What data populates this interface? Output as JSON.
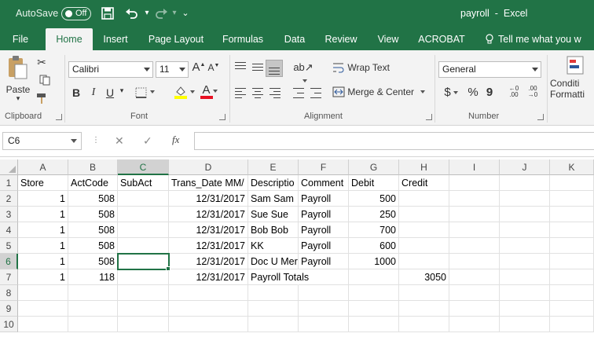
{
  "titlebar": {
    "autosave_label": "AutoSave",
    "autosave_state": "Off",
    "title": "payroll  -  Excel"
  },
  "tabs": [
    {
      "label": "File",
      "active": false
    },
    {
      "label": "Home",
      "active": true
    },
    {
      "label": "Insert",
      "active": false
    },
    {
      "label": "Page Layout",
      "active": false
    },
    {
      "label": "Formulas",
      "active": false
    },
    {
      "label": "Data",
      "active": false
    },
    {
      "label": "Review",
      "active": false
    },
    {
      "label": "View",
      "active": false
    },
    {
      "label": "ACROBAT",
      "active": false
    },
    {
      "label": "Tell me what you w",
      "active": false
    }
  ],
  "ribbon": {
    "clipboard": {
      "paste_label": "Paste",
      "group_label": "Clipboard"
    },
    "font": {
      "font_name": "Calibri",
      "font_size": "11",
      "group_label": "Font",
      "bold": "B",
      "italic": "I",
      "underline": "U",
      "font_color_glyph": "A",
      "font_color": "#e81123",
      "fill_color": "#ffff00"
    },
    "alignment": {
      "wrap_text": "Wrap Text",
      "merge_center": "Merge & Center",
      "group_label": "Alignment"
    },
    "number": {
      "format": "General",
      "group_label": "Number",
      "currency": "$",
      "percent": "%",
      "comma": "9",
      "inc_decimal": ".00",
      "dec_decimal": ".00"
    },
    "styles": {
      "conditional_line1": "Conditi",
      "conditional_line2": "Formatti"
    }
  },
  "formula_bar": {
    "name_box": "C6",
    "content": ""
  },
  "grid": {
    "columns": [
      "A",
      "B",
      "C",
      "D",
      "E",
      "F",
      "G",
      "H",
      "I",
      "J",
      "K"
    ],
    "selected_column": "C",
    "selected_row": "6",
    "rows": [
      {
        "num": "1",
        "cells": [
          "Store",
          "ActCode",
          "SubAct",
          "Trans_Date MM/",
          "Descriptio",
          "Comment",
          "Debit",
          "Credit",
          "",
          "",
          ""
        ]
      },
      {
        "num": "2",
        "cells": [
          "1",
          "508",
          "",
          "12/31/2017",
          "Sam Sam",
          "Payroll",
          "500",
          "",
          "",
          "",
          ""
        ]
      },
      {
        "num": "3",
        "cells": [
          "1",
          "508",
          "",
          "12/31/2017",
          "Sue Sue",
          "Payroll",
          "250",
          "",
          "",
          "",
          ""
        ]
      },
      {
        "num": "4",
        "cells": [
          "1",
          "508",
          "",
          "12/31/2017",
          "Bob Bob",
          "Payroll",
          "700",
          "",
          "",
          "",
          ""
        ]
      },
      {
        "num": "5",
        "cells": [
          "1",
          "508",
          "",
          "12/31/2017",
          "KK",
          "Payroll",
          "600",
          "",
          "",
          "",
          ""
        ]
      },
      {
        "num": "6",
        "cells": [
          "1",
          "508",
          "",
          "12/31/2017",
          "Doc U Mer",
          "Payroll",
          "1000",
          "",
          "",
          "",
          ""
        ]
      },
      {
        "num": "7",
        "cells": [
          "1",
          "118",
          "",
          "12/31/2017",
          "Payroll Totals",
          "",
          "",
          "3050",
          "",
          "",
          ""
        ]
      },
      {
        "num": "8",
        "cells": [
          "",
          "",
          "",
          "",
          "",
          "",
          "",
          "",
          "",
          "",
          ""
        ]
      },
      {
        "num": "9",
        "cells": [
          "",
          "",
          "",
          "",
          "",
          "",
          "",
          "",
          "",
          "",
          ""
        ]
      },
      {
        "num": "10",
        "cells": [
          "",
          "",
          "",
          "",
          "",
          "",
          "",
          "",
          "",
          "",
          ""
        ]
      }
    ]
  },
  "colors": {
    "excel_green": "#217346",
    "ribbon_bg": "#f3f3f3"
  }
}
